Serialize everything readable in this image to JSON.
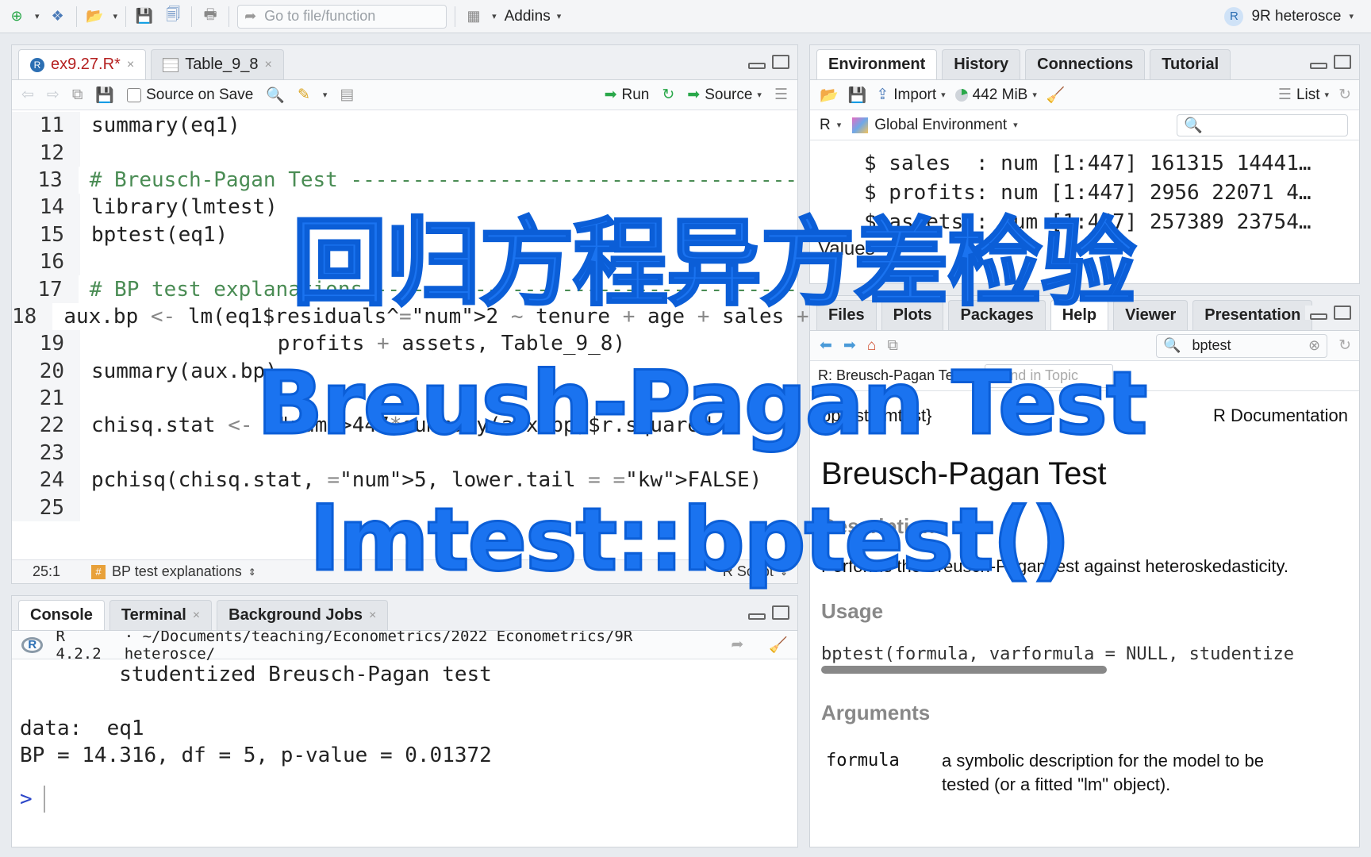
{
  "topbar": {
    "goto_placeholder": "Go to file/function",
    "addins_label": "Addins",
    "project_label": "9R heterosce"
  },
  "editor": {
    "tabs": [
      {
        "label": "ex9.27.R*",
        "active": true
      },
      {
        "label": "Table_9_8",
        "active": false
      }
    ],
    "source_on_save": "Source on Save",
    "run_label": "Run",
    "source_label": "Source",
    "lines": [
      {
        "n": "11",
        "text": "summary(eq1)"
      },
      {
        "n": "12",
        "text": ""
      },
      {
        "n": "13",
        "text": "# Breusch-Pagan Test ------------------------------------"
      },
      {
        "n": "14",
        "text": "library(lmtest)"
      },
      {
        "n": "15",
        "text": "bptest(eq1)"
      },
      {
        "n": "16",
        "text": ""
      },
      {
        "n": "17",
        "text": "# BP test explanations ----------------------------------"
      },
      {
        "n": "18",
        "text": "aux.bp <- lm(eq1$residuals^2 ~ tenure + age + sales +"
      },
      {
        "n": "19",
        "text": "               profits + assets, Table_9_8)"
      },
      {
        "n": "20",
        "text": "summary(aux.bp)"
      },
      {
        "n": "21",
        "text": ""
      },
      {
        "n": "22",
        "text": "chisq.stat <- 447*summary(aux.bp)$r.squared"
      },
      {
        "n": "23",
        "text": ""
      },
      {
        "n": "24",
        "text": "pchisq(chisq.stat, 5, lower.tail = FALSE)"
      },
      {
        "n": "25",
        "text": ""
      }
    ],
    "status_pos": "25:1",
    "status_section": "BP test explanations",
    "status_type": "R Script"
  },
  "console": {
    "tabs": [
      "Console",
      "Terminal",
      "Background Jobs"
    ],
    "r_version": "R 4.2.2",
    "path": "~/Documents/teaching/Econometrics/2022 Econometrics/9R heterosce/",
    "lines": [
      "        studentized Breusch-Pagan test",
      "",
      "data:  eq1",
      "BP = 14.316, df = 5, p-value = 0.01372"
    ],
    "prompt": ">"
  },
  "environment": {
    "tabs": [
      "Environment",
      "History",
      "Connections",
      "Tutorial"
    ],
    "import_label": "Import",
    "memory_label": "442 MiB",
    "list_label": "List",
    "r_label": "R",
    "scope_label": "Global Environment",
    "rows": [
      "$ sales  : num [1:447] 161315 14441…",
      "$ profits: num [1:447] 2956 22071 4…",
      "$ assets : num [1:447] 257389 23754…"
    ],
    "values_label": "Values"
  },
  "help": {
    "tabs": [
      "Files",
      "Plots",
      "Packages",
      "Help",
      "Viewer",
      "Presentation"
    ],
    "search_value": "bptest",
    "topic_label": "R: Breusch-Pagan Test",
    "find_placeholder": "Find in Topic",
    "pkg_label": "bptest {lmtest}",
    "rdoc_label": "R Documentation",
    "title": "Breusch-Pagan Test",
    "description_head": "Description",
    "description": "Performs the Breusch-Pagan test against heteroskedasticity.",
    "usage_head": "Usage",
    "usage": "bptest(formula, varformula = NULL, studentize",
    "arguments_head": "Arguments",
    "arg_name": "formula",
    "arg_desc_1": "a symbolic description for the model to be",
    "arg_desc_2": "tested (or a fitted \"lm\" object)."
  },
  "overlay": {
    "line1": "回归方程异方差检验",
    "line2": "Breush-Pagan Test",
    "line3": "lmtest::bptest()"
  },
  "colors": {
    "overlay_blue": "#1a73f0",
    "comment_green": "#4a8c54",
    "number_blue": "#2a40c8"
  }
}
